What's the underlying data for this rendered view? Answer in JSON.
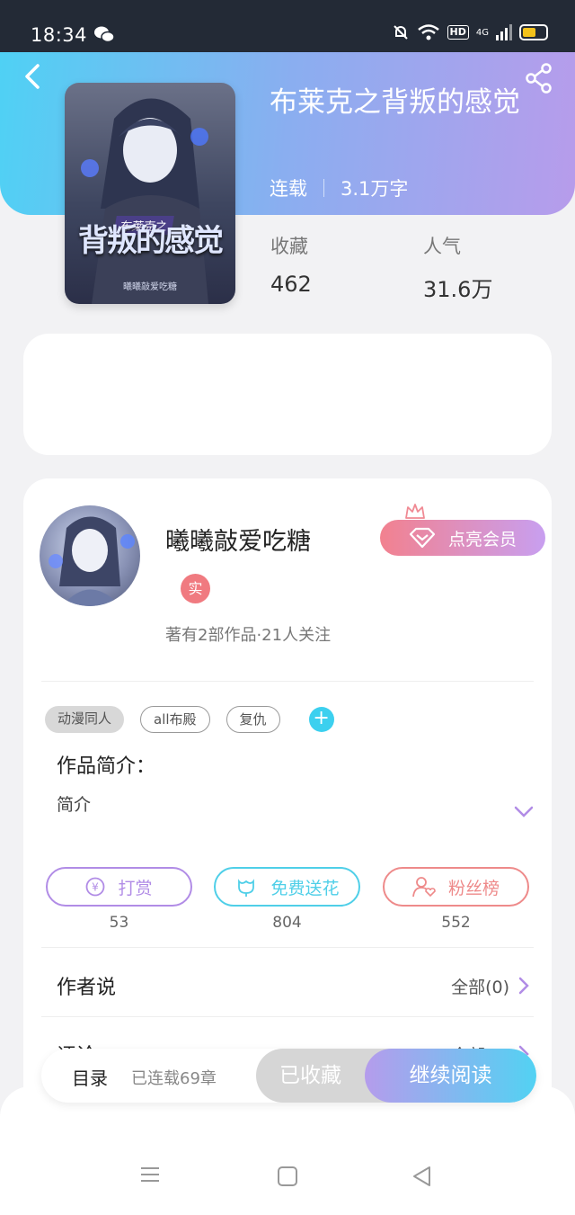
{
  "status_bar": {
    "time": "18:34",
    "hd": "HD",
    "signal": "4G"
  },
  "book": {
    "title": "布莱克之背叛的感觉",
    "status": "连载",
    "word_count": "3.1万字",
    "cover_title": "背叛的感觉",
    "cover_banner": "布莱克之",
    "cover_author": "曦曦敲爱吃糖"
  },
  "stats": {
    "favorites": {
      "label": "收藏",
      "value": "462"
    },
    "popularity": {
      "label": "人气",
      "value": "31.6万"
    }
  },
  "author": {
    "name": "曦曦敲爱吃糖",
    "badge": "实",
    "info": "著有2部作品·21人关注",
    "vip_button": "点亮会员"
  },
  "tags": [
    "动漫同人",
    "all布殿",
    "复仇"
  ],
  "intro": {
    "label": "作品简介：",
    "text": "简介"
  },
  "actions": [
    {
      "label": "打赏",
      "count": "53",
      "color": "#b18ce6"
    },
    {
      "label": "免费送花",
      "count": "804",
      "color": "#4fcfe8"
    },
    {
      "label": "粉丝榜",
      "count": "552",
      "color": "#ee8a8a"
    }
  ],
  "author_says": {
    "title": "作者说",
    "right": "全部(0)"
  },
  "comments": {
    "title": "评论",
    "right": "全部(0)"
  },
  "bottom_bar": {
    "catalog": "目录",
    "progress": "已连载69章",
    "saved": "已收藏",
    "read": "继续阅读"
  }
}
